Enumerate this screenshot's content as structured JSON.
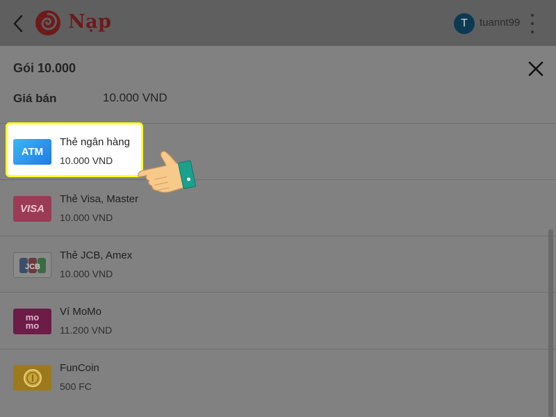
{
  "header": {
    "title": "Nạp",
    "avatar_initial": "T",
    "username": "tuannt99"
  },
  "package": {
    "title": "Gói 10.000",
    "price_label": "Giá bán",
    "price_value": "10.000 VND"
  },
  "payment_methods": [
    {
      "name": "Thẻ ngân hàng",
      "price": "10.000 VND",
      "icon": "atm-card-icon",
      "icon_text": "ATM",
      "highlighted": true
    },
    {
      "name": "Thẻ Visa, Master",
      "price": "10.000 VND",
      "icon": "visa-icon",
      "icon_text": "VISA"
    },
    {
      "name": "Thẻ JCB, Amex",
      "price": "10.000 VND",
      "icon": "jcb-icon",
      "icon_text": "JCB"
    },
    {
      "name": "Ví MoMo",
      "price": "11.200 VND",
      "icon": "momo-icon",
      "icon_text_line1": "mo",
      "icon_text_line2": "mo"
    },
    {
      "name": "FunCoin",
      "price": "500 FC",
      "icon": "funcoin-icon"
    }
  ],
  "colors": {
    "highlight_border": "#ffff22",
    "atm_blue": "#1e7be6",
    "overlay_gray": "#808080"
  }
}
